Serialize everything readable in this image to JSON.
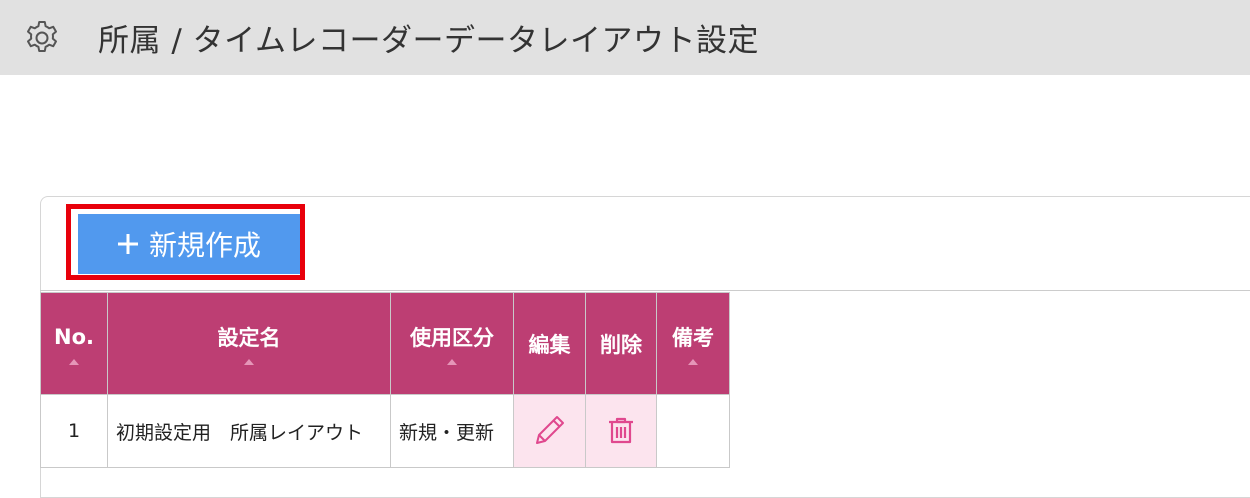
{
  "header": {
    "icon": "gear-icon",
    "title": "所属 / タイムレコーダーデータレイアウト設定"
  },
  "toolbar": {
    "new_button_label": "新規作成",
    "new_button_icon": "plus-icon",
    "new_button_color": "#5199ee",
    "highlight_color": "#e8000b"
  },
  "table": {
    "header_color": "#bd3e73",
    "action_cell_color": "#fce4ee",
    "icon_color": "#e0488e",
    "columns": {
      "no": "No.",
      "name": "設定名",
      "usage": "使用区分",
      "edit": "編集",
      "delete": "削除",
      "note": "備考"
    },
    "rows": [
      {
        "no": "1",
        "name": "初期設定用　所属レイアウト",
        "usage": "新規・更新",
        "edit_icon": "pencil-icon",
        "delete_icon": "trash-icon",
        "note": ""
      }
    ]
  }
}
